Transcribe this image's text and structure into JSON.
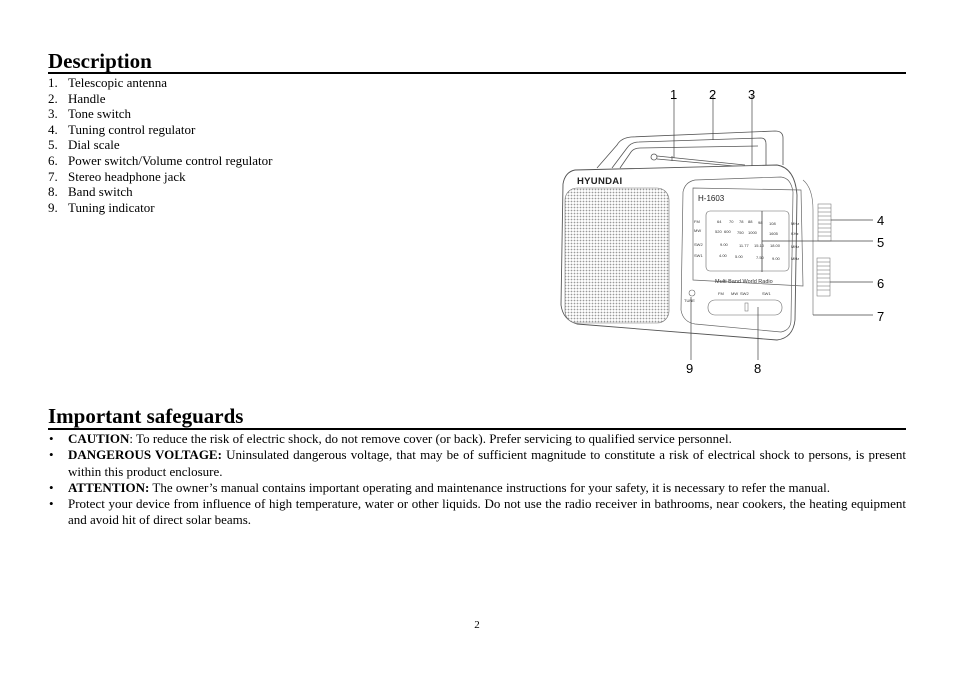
{
  "description": {
    "title": "Description",
    "items": [
      {
        "num": "1.",
        "label": "Telescopic antenna"
      },
      {
        "num": "2.",
        "label": "Handle"
      },
      {
        "num": "3.",
        "label": "Tone switch"
      },
      {
        "num": "4.",
        "label": "Tuning control regulator"
      },
      {
        "num": "5.",
        "label": "Dial scale"
      },
      {
        "num": "6.",
        "label": "Power switch/Volume control regulator"
      },
      {
        "num": "7.",
        "label": "Stereo headphone jack"
      },
      {
        "num": "8.",
        "label": "Band switch"
      },
      {
        "num": "9.",
        "label": "Tuning indicator"
      }
    ]
  },
  "diagram": {
    "brand": "HYUNDAI",
    "model": "H-1603",
    "subtitle": "Multi Band World Radio",
    "tune_label": "TUNE",
    "callouts": [
      "1",
      "2",
      "3",
      "4",
      "5",
      "6",
      "7",
      "8",
      "9"
    ],
    "dial": {
      "bands": [
        {
          "name": "FM",
          "marks": [
            "64",
            "70",
            "78",
            "88",
            "98",
            "108"
          ],
          "unit": "MHz"
        },
        {
          "name": "MW",
          "marks": [
            "520",
            "600",
            "750",
            "1000",
            "1605"
          ],
          "unit": "KHz"
        },
        {
          "name": "SW2",
          "marks": [
            "9.00",
            "11.77",
            "15.10",
            "18.00"
          ],
          "unit": "MHz"
        },
        {
          "name": "SW1",
          "marks": [
            "4.00",
            "5.00",
            "7.50",
            "9.00"
          ],
          "unit": "MHz"
        }
      ]
    },
    "band_switch_labels": [
      "FM",
      "MW",
      "SW2",
      "SW1"
    ]
  },
  "safeguards": {
    "title": "Important safeguards",
    "items": [
      {
        "lead": "CAUTION",
        "sep": ":",
        "text": " To reduce the risk of electric shock, do not remove cover (or back). Prefer servicing to qualified service personnel."
      },
      {
        "lead": "DANGEROUS VOLTAGE:",
        "sep": "",
        "text": " Uninsulated dangerous voltage, that may be of sufficient magnitude to constitute a risk of electrical shock to persons, is present within this product enclosure."
      },
      {
        "lead": "ATTENTION:",
        "sep": "",
        "text": " The owner’s manual contains important operating and maintenance instructions for your safety, it is necessary to refer the manual."
      },
      {
        "lead": "",
        "sep": "",
        "text": "Protect your device from influence of high temperature, water or other liquids. Do not use the radio receiver in bathrooms, near cookers, the heating equipment and avoid hit of direct solar beams."
      }
    ]
  },
  "footer": {
    "page_number": "2"
  }
}
